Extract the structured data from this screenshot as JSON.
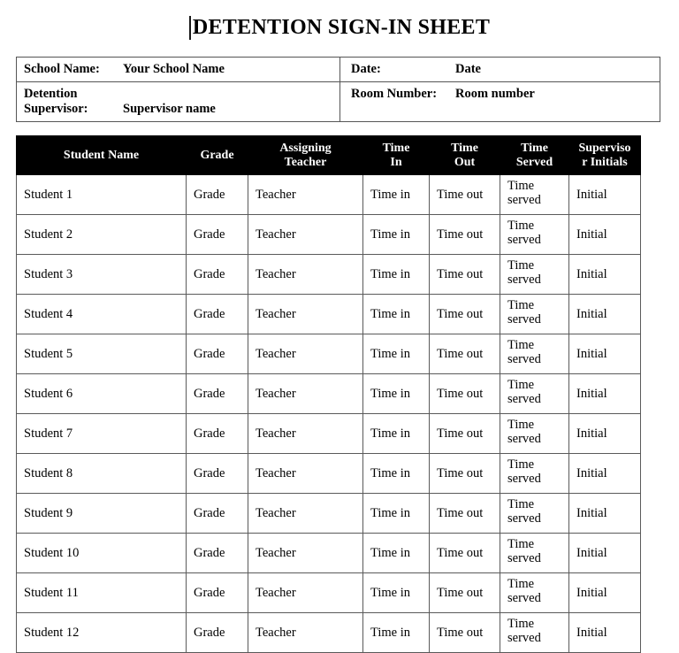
{
  "document": {
    "title": "DETENTION SIGN-IN SHEET",
    "caret_present": true
  },
  "info": {
    "school_label": "School Name:",
    "school_value": "Your School Name",
    "supervisor_label_line1": "Detention",
    "supervisor_label_line2": "Supervisor:",
    "supervisor_value": "Supervisor name",
    "date_label": "Date:",
    "date_value": "Date",
    "room_label": "Room Number:",
    "room_value": "Room number"
  },
  "table": {
    "headers": [
      {
        "line1": "Student Name",
        "line2": ""
      },
      {
        "line1": "Grade",
        "line2": ""
      },
      {
        "line1": "Assigning",
        "line2": "Teacher"
      },
      {
        "line1": "Time",
        "line2": "In"
      },
      {
        "line1": "Time",
        "line2": "Out"
      },
      {
        "line1": "Time",
        "line2": "Served"
      },
      {
        "line1": "Superviso",
        "line2": "r Initials"
      }
    ],
    "rows": [
      {
        "name": "Student 1",
        "grade": "Grade",
        "teacher": "Teacher",
        "time_in": "Time in",
        "time_out": "Time out",
        "time_served": "Time served",
        "initials": "Initial"
      },
      {
        "name": "Student 2",
        "grade": "Grade",
        "teacher": "Teacher",
        "time_in": "Time in",
        "time_out": "Time out",
        "time_served": "Time served",
        "initials": "Initial"
      },
      {
        "name": "Student 3",
        "grade": "Grade",
        "teacher": "Teacher",
        "time_in": "Time in",
        "time_out": "Time out",
        "time_served": "Time served",
        "initials": "Initial"
      },
      {
        "name": "Student 4",
        "grade": "Grade",
        "teacher": "Teacher",
        "time_in": "Time in",
        "time_out": "Time out",
        "time_served": "Time served",
        "initials": "Initial"
      },
      {
        "name": "Student 5",
        "grade": "Grade",
        "teacher": "Teacher",
        "time_in": "Time in",
        "time_out": "Time out",
        "time_served": "Time served",
        "initials": "Initial"
      },
      {
        "name": "Student 6",
        "grade": "Grade",
        "teacher": "Teacher",
        "time_in": "Time in",
        "time_out": "Time out",
        "time_served": "Time served",
        "initials": "Initial"
      },
      {
        "name": "Student 7",
        "grade": "Grade",
        "teacher": "Teacher",
        "time_in": "Time in",
        "time_out": "Time out",
        "time_served": "Time served",
        "initials": "Initial"
      },
      {
        "name": "Student 8",
        "grade": "Grade",
        "teacher": "Teacher",
        "time_in": "Time in",
        "time_out": "Time out",
        "time_served": "Time served",
        "initials": "Initial"
      },
      {
        "name": "Student 9",
        "grade": "Grade",
        "teacher": "Teacher",
        "time_in": "Time in",
        "time_out": "Time out",
        "time_served": "Time served",
        "initials": "Initial"
      },
      {
        "name": "Student 10",
        "grade": "Grade",
        "teacher": "Teacher",
        "time_in": "Time in",
        "time_out": "Time out",
        "time_served": "Time served",
        "initials": "Initial"
      },
      {
        "name": "Student 11",
        "grade": "Grade",
        "teacher": "Teacher",
        "time_in": "Time in",
        "time_out": "Time out",
        "time_served": "Time served",
        "initials": "Initial"
      },
      {
        "name": "Student 12",
        "grade": "Grade",
        "teacher": "Teacher",
        "time_in": "Time in",
        "time_out": "Time out",
        "time_served": "Time served",
        "initials": "Initial"
      }
    ]
  },
  "colors": {
    "header_background": "#000000",
    "header_text": "#ffffff",
    "page_background": "#ffffff",
    "border": "#5a5a5a",
    "text": "#000000"
  }
}
